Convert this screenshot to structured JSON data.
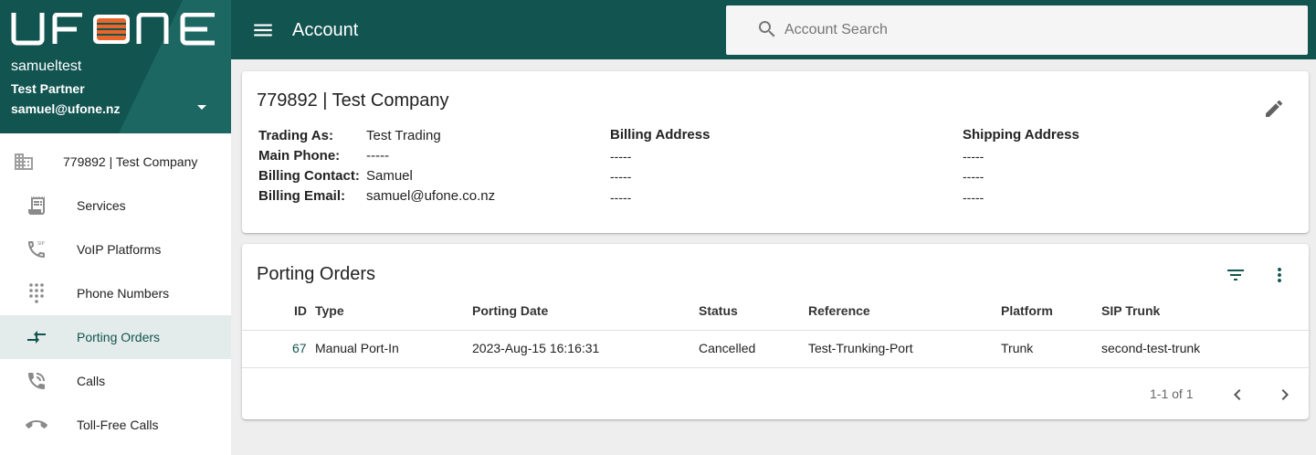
{
  "brand": {
    "logo_text": "UFONE",
    "accent": "#115450",
    "logo_orange": "#e8662a"
  },
  "user": {
    "name": "samueltest",
    "partner": "Test Partner",
    "email": "samuel@ufone.nz"
  },
  "sidebar": {
    "company": {
      "label": "779892 | Test Company",
      "icon": "building-icon"
    },
    "items": [
      {
        "label": "Services",
        "icon": "receipt-icon",
        "active": false
      },
      {
        "label": "VoIP Platforms",
        "icon": "sip-phone-icon",
        "active": false
      },
      {
        "label": "Phone Numbers",
        "icon": "dialpad-icon",
        "active": false
      },
      {
        "label": "Porting Orders",
        "icon": "porting-arrows-icon",
        "active": true
      },
      {
        "label": "Calls",
        "icon": "phone-in-talk-icon",
        "active": false
      },
      {
        "label": "Toll-Free Calls",
        "icon": "phone-hangup-icon",
        "active": false
      }
    ]
  },
  "topbar": {
    "title": "Account",
    "search_placeholder": "Account Search"
  },
  "account": {
    "title": "779892 | Test Company",
    "fields": [
      {
        "key": "Trading As:",
        "value": "Test Trading"
      },
      {
        "key": "Main Phone:",
        "value": "-----"
      },
      {
        "key": "Billing Contact:",
        "value": "Samuel"
      },
      {
        "key": "Billing Email:",
        "value": "samuel@ufone.co.nz"
      }
    ],
    "billing_address": {
      "heading": "Billing Address",
      "lines": [
        "-----",
        "-----",
        "-----"
      ]
    },
    "shipping_address": {
      "heading": "Shipping Address",
      "lines": [
        "-----",
        "-----",
        "-----"
      ]
    }
  },
  "porting": {
    "title": "Porting Orders",
    "columns": [
      "ID",
      "Type",
      "Porting Date",
      "Status",
      "Reference",
      "Platform",
      "SIP Trunk"
    ],
    "rows": [
      {
        "id": "67",
        "type": "Manual Port-In",
        "date": "2023-Aug-15 16:16:31",
        "status": "Cancelled",
        "reference": "Test-Trunking-Port",
        "platform": "Trunk",
        "sip_trunk": "second-test-trunk"
      }
    ],
    "pagination": "1-1 of 1"
  }
}
